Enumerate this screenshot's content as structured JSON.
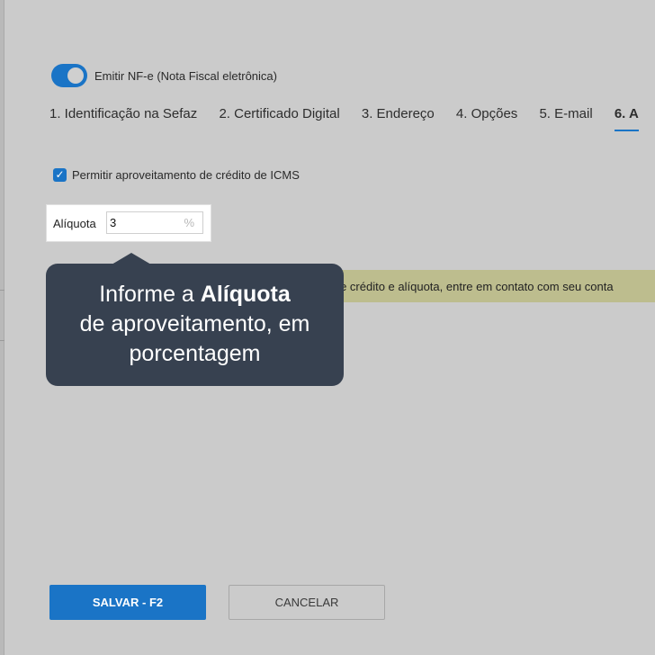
{
  "toggle": {
    "label": "Emitir NF-e (Nota Fiscal eletrônica)",
    "on": true
  },
  "tabs": [
    {
      "label": "1. Identificação na Sefaz"
    },
    {
      "label": "2. Certificado Digital"
    },
    {
      "label": "3. Endereço"
    },
    {
      "label": "4. Opções"
    },
    {
      "label": "5. E-mail"
    },
    {
      "label": "6. A"
    }
  ],
  "credit": {
    "checkbox_label": "Permitir aproveitamento de crédito de ICMS",
    "checked": true,
    "aliquota_label": "Alíquota",
    "aliquota_value": "3",
    "aliquota_unit": "%"
  },
  "warning": {
    "text": "o de crédito e alíquota, entre em contato com seu conta"
  },
  "tooltip": {
    "line1_prefix": "Informe a ",
    "line1_bold": "Alíquota",
    "line2": "de aproveitamento, em",
    "line3": "porcentagem"
  },
  "buttons": {
    "save": "SALVAR - F2",
    "cancel": "CANCELAR"
  },
  "colors": {
    "accent": "#1a74c6",
    "tooltip_bg": "#374150",
    "warning_bg": "#bdbd8e",
    "overlay": "#cbcbcb"
  }
}
